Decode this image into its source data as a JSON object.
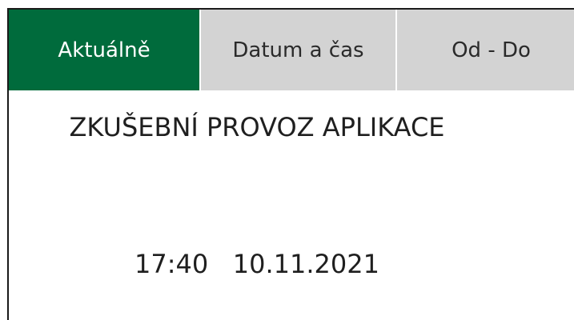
{
  "tabs": {
    "current": "Aktuálně",
    "date_time": "Datum a čas",
    "from_to": "Od - Do"
  },
  "colors": {
    "accent": "#006b3c",
    "tab_inactive": "#d3d3d3"
  },
  "main": {
    "banner": "ZKUŠEBNÍ PROVOZ APLIKACE",
    "time": "17:40",
    "date": "10.11.2021"
  }
}
